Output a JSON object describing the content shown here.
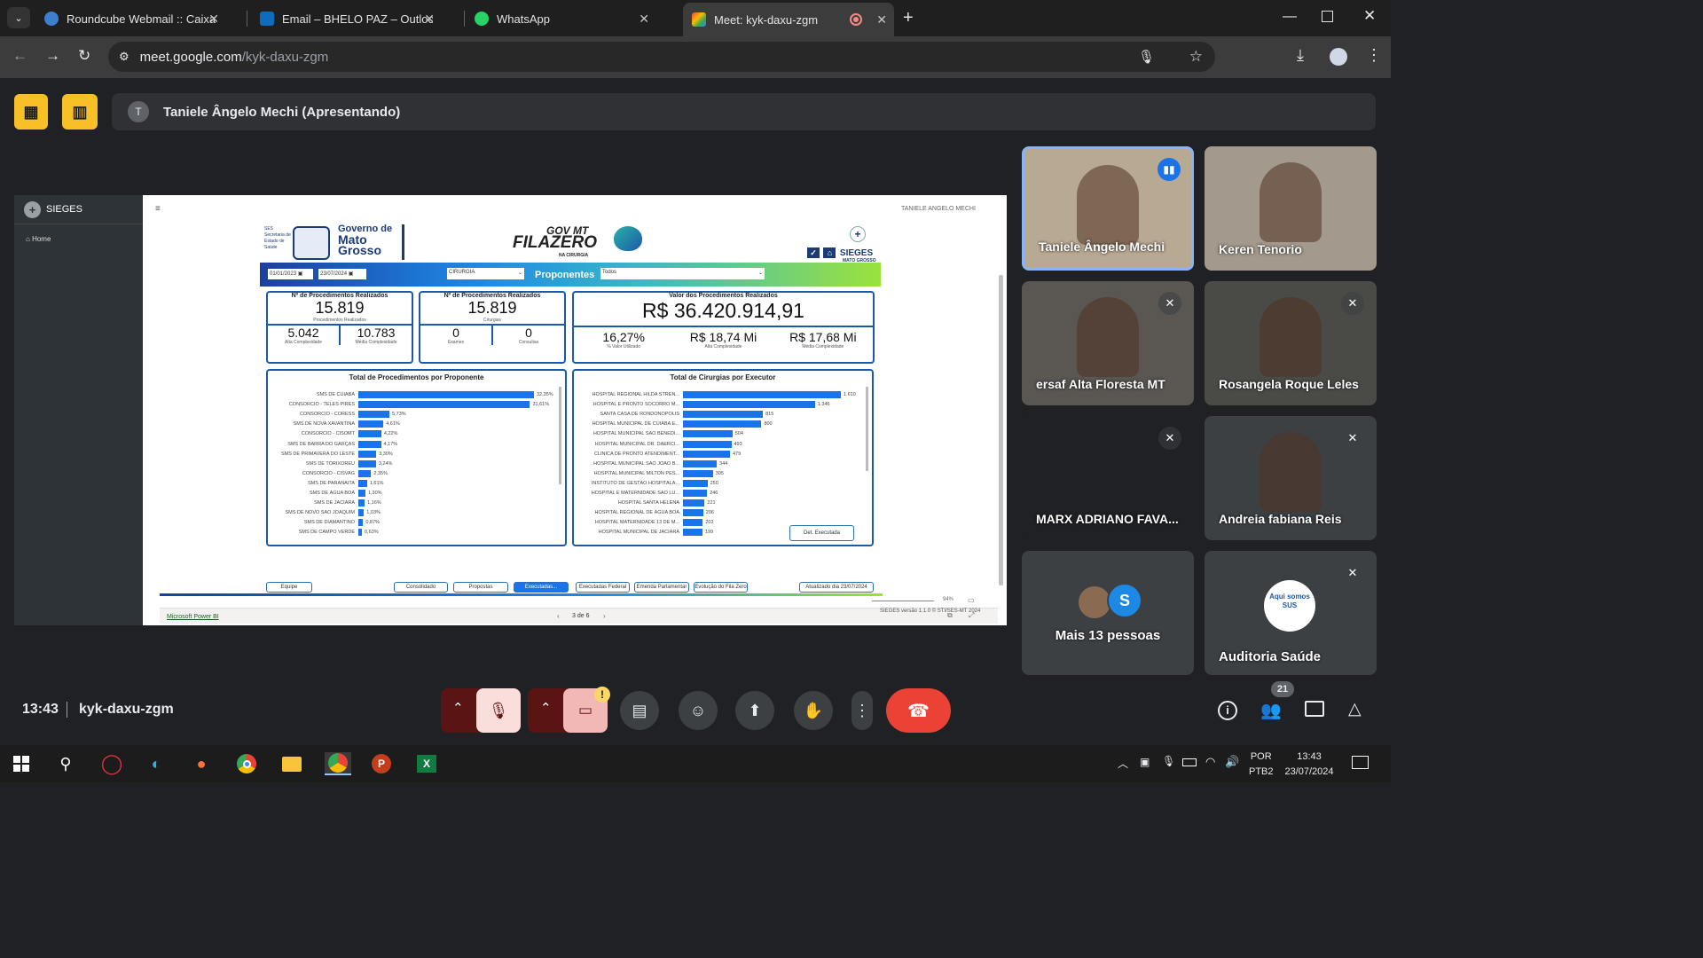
{
  "tabs": [
    {
      "label": "Roundcube Webmail :: Caixa de",
      "color": "#3d7ed1"
    },
    {
      "label": "Email – BHELO PAZ – Outlook",
      "color": "#0f6cbd"
    },
    {
      "label": "WhatsApp",
      "color": "#25d366"
    },
    {
      "label": "Meet: kyk-daxu-zgm",
      "color": "#1e8e3e"
    }
  ],
  "new_tab": "+",
  "url": {
    "domain": "meet.google.com",
    "path": "/kyk-daxu-zgm"
  },
  "presenter": {
    "initial": "T",
    "label": "Taniele Ângelo Mechi (Apresentando)"
  },
  "sieges": {
    "brand": "SIEGES",
    "home": "Home",
    "user": "TANIELE ANGELO MECHI",
    "footer": "SIEGES versão 1.1.0 © STI/SES-MT 2024",
    "gov_line1": "Governo de",
    "gov_line2": "Mato",
    "gov_line3": "Grosso",
    "ses": "SES Secretaria de Estado de Saúde",
    "fila_top": "GOV MT",
    "fila_main": "FILAZERO",
    "fila_sub": "NA CIRURGIA",
    "sieges_logo": "SIEGES",
    "sieges_logo_sub": "MATO GROSSO",
    "filters": {
      "date_from": "01/01/2023",
      "date_to": "23/07/2024",
      "type": "CIRURGIA",
      "proponentes_label": "Proponentes",
      "proponentes_value": "Todos"
    },
    "kpi1": {
      "title": "Nº de Procedimentos Realizados",
      "value": "15.819",
      "sub": "Procedimentos Realizados",
      "a_val": "5.042",
      "a_lbl": "Alta Complexidade",
      "b_val": "10.783",
      "b_lbl": "Média Complexidade"
    },
    "kpi2": {
      "title": "Nº de Procedimentos Realizados",
      "value": "15.819",
      "sub": "Cirurgias",
      "a_val": "0",
      "a_lbl": "Exames",
      "b_val": "0",
      "b_lbl": "Consultas"
    },
    "kpi3": {
      "title": "Valor dos Procedimentos Realizados",
      "value": "R$ 36.420.914,91",
      "a_val": "16,27%",
      "a_lbl": "% Valor Utilizado",
      "b_val": "R$ 18,74 Mi",
      "b_lbl": "Alta Complexidade",
      "c_val": "R$ 17,68 Mi",
      "c_lbl": "Média Complexidade"
    },
    "chart1_title": "Total de Procedimentos por Proponente",
    "chart2_title": "Total de Cirurgias por Executor",
    "det_button": "Det. Executada",
    "pages": [
      "Equipe",
      "Consolidado",
      "Propostas",
      "Executadas...",
      "Executadas Federal",
      "Emenda Parlamentar",
      "Evolução do Fila Zero",
      "Atualizado dia 23/07/2024"
    ],
    "powerbi": "Microsoft Power BI",
    "page_nav": "3 de 6",
    "zoom": "94%"
  },
  "chart_data": [
    {
      "type": "bar",
      "title": "Total de Procedimentos por Proponente",
      "categories": [
        "SMS DE CUIABÁ",
        "CONSÓRCIO - TELES PIRES",
        "CONSÓRCIO - CORESS",
        "SMS DE NOVA XAVANTINA",
        "CONSÓRCIO - CISOMT",
        "SMS DE BARRA DO GARÇAS",
        "SMS DE PRIMAVERA DO LESTE",
        "SMS DE TORIXORÉU",
        "CONSÓRCIO - CISVAG",
        "SMS DE PARANAITA",
        "SMS DE ÁGUA BOA",
        "SMS DE JACIARA",
        "SMS DE NOVO SÃO JOAQUIM",
        "SMS DE DIAMANTINO",
        "SMS DE CAMPO VERDE"
      ],
      "values": [
        32.35,
        31.61,
        5.73,
        4.61,
        4.22,
        4.17,
        3.3,
        3.24,
        2.35,
        1.61,
        1.3,
        1.16,
        1.03,
        0.87,
        0.63
      ],
      "labels": [
        "32,35%",
        "31,61%",
        "5,73%",
        "4,61%",
        "4,22%",
        "4,17%",
        "3,30%",
        "3,24%",
        "2,35%",
        "1,61%",
        "1,30%",
        "1,16%",
        "1,03%",
        "0,87%",
        "0,63%"
      ]
    },
    {
      "type": "bar",
      "title": "Total de Cirurgias por Executor",
      "categories": [
        "HOSPITAL REGIONAL HILDA STREN...",
        "HOSPITAL E PRONTO SOCORRO M...",
        "SANTA CASA DE RONDONÓPOLIS",
        "HOSPITAL MUNICIPAL DE CUIABÁ E...",
        "HOSPITAL MUNICIPAL SÃO BENEDI...",
        "HOSPITAL MUNICIPAL DR. DAÉRCI...",
        "CLÍNICA DE PRONTO ATENDIMENT...",
        "HOSPITAL MUNICIPAL SÃO JOÃO B...",
        "HOSPITAL MUNICIPAL MILTON PES...",
        "INSTITUTO DE GESTÃO HOSPITALA...",
        "HOSPITAL E MATERNIDADE SÃO LU...",
        "HOSPITAL SANTA HELENA",
        "HOSPITAL REGIONAL DE ÁGUA BOA",
        "HOSPITAL MATERNIDADE 13 DE M...",
        "HOSPITAL MUNICIPAL DE JACIARA"
      ],
      "values": [
        1610,
        1346,
        815,
        800,
        504,
        493,
        479,
        344,
        305,
        250,
        246,
        221,
        206,
        202,
        199
      ],
      "labels": [
        "1.610",
        "1.346",
        "815",
        "800",
        "504",
        "493",
        "479",
        "344",
        "305",
        "250",
        "246",
        "221",
        "206",
        "202",
        "199"
      ]
    }
  ],
  "participants": [
    {
      "name": "Taniele Ângelo Mechi",
      "muted": false,
      "bg": "#b8a993"
    },
    {
      "name": "Keren Tenorio",
      "muted": false,
      "bg": "#a39a8d"
    },
    {
      "name": "ersaf Alta Floresta MT",
      "muted": true,
      "bg": "#5a5652"
    },
    {
      "name": "Rosangela Roque Leles",
      "muted": true,
      "bg": "#4a4b46"
    },
    {
      "name": "MARX ADRIANO FAVA...",
      "muted": true,
      "bg": "#202124"
    },
    {
      "name": "Andreia fabiana Reis",
      "muted": true,
      "bg": "#3c4043"
    },
    {
      "name": "Mais 13 pessoas",
      "muted": false,
      "bg": "#3c4043"
    },
    {
      "name": "Auditoria Saúde",
      "muted": true,
      "bg": "#3c4043"
    }
  ],
  "more_avatar": "S",
  "sus_logo": "Aqui somos SUS",
  "meeting": {
    "time": "13:43",
    "code": "kyk-daxu-zgm",
    "people_count": "21",
    "warn": "!"
  },
  "taskbar": {
    "lang1": "POR",
    "lang2": "PTB2",
    "time": "13:43",
    "date": "23/07/2024"
  },
  "colors": {
    "end_call": "#ea4335",
    "mic_off": "#f9dedc",
    "bar": "#1a73e8",
    "yellow": "#f6c026"
  }
}
